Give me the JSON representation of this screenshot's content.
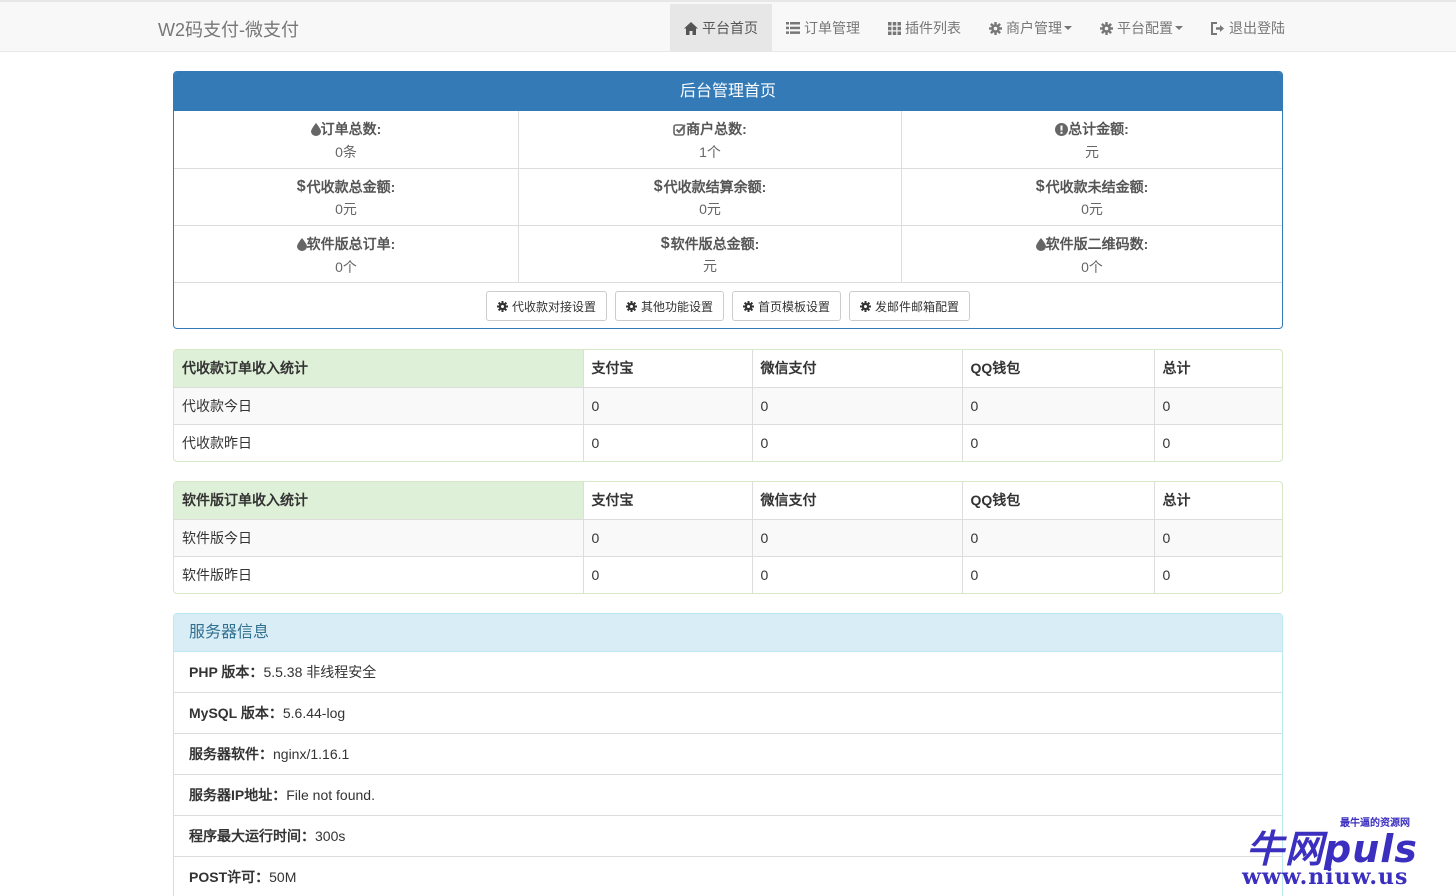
{
  "brand": "W2码支付-微支付",
  "nav": [
    {
      "label": "平台首页",
      "icon": "home-icon"
    },
    {
      "label": "订单管理",
      "icon": "list-icon"
    },
    {
      "label": "插件列表",
      "icon": "grid-icon"
    },
    {
      "label": "商户管理",
      "icon": "gear-icon"
    },
    {
      "label": "平台配置",
      "icon": "gear-icon"
    },
    {
      "label": "退出登陆",
      "icon": "logout-icon"
    }
  ],
  "dashboard": {
    "title": "后台管理首页",
    "stats": [
      {
        "label": "订单总数:",
        "value": "0条",
        "icon": "drop-icon"
      },
      {
        "label": "商户总数:",
        "value": "1个",
        "icon": "check-icon"
      },
      {
        "label": "总计金额:",
        "value": "元",
        "icon": "info-icon"
      },
      {
        "label": "代收款总金额:",
        "value": "0元",
        "icon": "dollar-icon"
      },
      {
        "label": "代收款结算余额:",
        "value": "0元",
        "icon": "dollar-icon"
      },
      {
        "label": "代收款未结金额:",
        "value": "0元",
        "icon": "dollar-icon"
      },
      {
        "label": "软件版总订单:",
        "value": "0个",
        "icon": "drop-icon"
      },
      {
        "label": "软件版总金额:",
        "value": "元",
        "icon": "dollar-icon"
      },
      {
        "label": "软件版二维码数:",
        "value": "0个",
        "icon": "drop-icon"
      }
    ],
    "buttons": [
      "代收款对接设置",
      "其他功能设置",
      "首页模板设置",
      "发邮件邮箱配置"
    ]
  },
  "table1": {
    "headers": [
      "代收款订单收入统计",
      "支付宝",
      "微信支付",
      "QQ钱包",
      "总计"
    ],
    "rows": [
      [
        "代收款今日",
        "0",
        "0",
        "0",
        "0"
      ],
      [
        "代收款昨日",
        "0",
        "0",
        "0",
        "0"
      ]
    ]
  },
  "table2": {
    "headers": [
      "软件版订单收入统计",
      "支付宝",
      "微信支付",
      "QQ钱包",
      "总计"
    ],
    "rows": [
      [
        "软件版今日",
        "0",
        "0",
        "0",
        "0"
      ],
      [
        "软件版昨日",
        "0",
        "0",
        "0",
        "0"
      ]
    ]
  },
  "server": {
    "title": "服务器信息",
    "items": [
      {
        "label": "PHP 版本：",
        "value": "5.5.38 非线程安全"
      },
      {
        "label": "MySQL 版本：",
        "value": "5.6.44-log"
      },
      {
        "label": "服务器软件：",
        "value": "nginx/1.16.1"
      },
      {
        "label": "服务器IP地址：",
        "value": "File not found."
      },
      {
        "label": "程序最大运行时间：",
        "value": "300s"
      },
      {
        "label": "POST许可：",
        "value": "50M"
      }
    ]
  },
  "watermark": {
    "big": "牛网puls",
    "small": "最牛逼的资源网",
    "url": "www.niuw.us"
  }
}
